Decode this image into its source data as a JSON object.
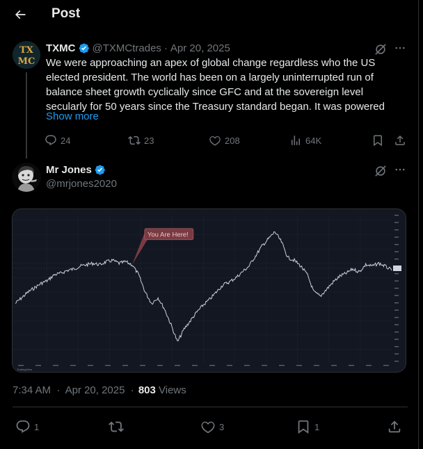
{
  "header": {
    "title": "Post"
  },
  "thread": {
    "parent": {
      "avatar_text": [
        "TX",
        "MC"
      ],
      "name": "TXMC",
      "handle": "@TXMCtrades",
      "separator": "·",
      "date": "Apr 20, 2025",
      "lines": [
        "We were approaching an apex of global change regardless who the US",
        "elected president. The world has been on a largely uninterrupted run of",
        "balance sheet growth cyclically since GFC and at the sovereign level",
        "secularly for 50 years since the Treasury standard began. It was powered"
      ],
      "show_more": "Show more",
      "actions": {
        "replies": "24",
        "reposts": "23",
        "likes": "208",
        "views": "64K"
      }
    },
    "main": {
      "name": "Mr Jones",
      "handle": "@mrjones2020",
      "media": {
        "annotation": "You Are Here!",
        "watermark": "TradingView",
        "chart_data": {
          "type": "line",
          "title": "",
          "series": [
            {
              "values": [
                0.42,
                0.46,
                0.5,
                0.53,
                0.56,
                0.58,
                0.62,
                0.63,
                0.65,
                0.66,
                0.68,
                0.69,
                0.7,
                0.69,
                0.71,
                0.72,
                0.7,
                0.71,
                0.69,
                0.62,
                0.5,
                0.42,
                0.46,
                0.38,
                0.27,
                0.15,
                0.24,
                0.3,
                0.36,
                0.41,
                0.45,
                0.5,
                0.55,
                0.57,
                0.6,
                0.64,
                0.68,
                0.75,
                0.82,
                0.87,
                0.92,
                0.85,
                0.74,
                0.72,
                0.68,
                0.62,
                0.5,
                0.47,
                0.52,
                0.57,
                0.61,
                0.63,
                0.66,
                0.64,
                0.69,
                0.68,
                0.7,
                0.68,
                0.65
              ]
            }
          ],
          "annotation_index": 18,
          "ylim": [
            0,
            1
          ]
        }
      },
      "time": "7:34 AM",
      "separator": "·",
      "date": "Apr 20, 2025",
      "views_count": "803",
      "views_label": "Views",
      "actions": {
        "replies": "1",
        "reposts": "",
        "likes": "3",
        "bookmarks": "1"
      }
    }
  },
  "colors": {
    "background": "#000000",
    "text": "#e7e9ea",
    "muted": "#71767b",
    "link": "#1d9bf0",
    "verified": "#1d9bf0",
    "chart_bg": "#131722",
    "chart_line": "#c9d1e0",
    "annotation_bg": "#7a3a42"
  },
  "icons": [
    "back-arrow-icon",
    "verified-badge-icon",
    "grok-icon",
    "more-icon",
    "reply-icon",
    "repost-icon",
    "like-icon",
    "views-icon",
    "bookmark-icon",
    "share-icon"
  ]
}
